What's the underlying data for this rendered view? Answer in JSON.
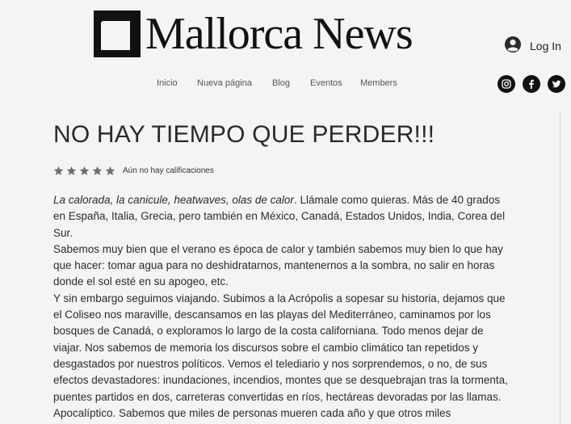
{
  "site": {
    "name": "Mallorca News"
  },
  "header": {
    "login_label": "Log In",
    "nav": [
      {
        "label": "Inicio"
      },
      {
        "label": "Nueva página"
      },
      {
        "label": "Blog"
      },
      {
        "label": "Eventos"
      },
      {
        "label": "Members"
      }
    ],
    "social": [
      "instagram-icon",
      "facebook-icon",
      "twitter-icon"
    ]
  },
  "post": {
    "title": "NO HAY TIEMPO QUE PERDER!!!",
    "rating": {
      "stars": 5,
      "value": 0,
      "label": "Aún no hay calificaciones"
    },
    "intro_italic": "La calorada, la canicule, heatwaves, olas de calor",
    "intro_rest": ". Llámale como quieras. Más de 40 grados en España, Italia, Grecia, pero también en México, Canadá, Estados Unidos, India, Corea del Sur.",
    "p2": "Sabemos muy bien que el verano es época de calor y también sabemos muy bien lo que hay que hacer: tomar agua para no deshidratarnos, mantenernos a la sombra, no salir en horas donde el sol esté en su apogeo, etc.",
    "p3": "Y sin embargo seguimos viajando. Subimos a la Acrópolis a sopesar su historia, dejamos que el Coliseo nos maraville, descansamos en las playas del Mediterráneo, caminamos por los bosques de Canadá, o exploramos lo largo de la costa californiana. Todo menos dejar de viajar. Nos sabemos de memoria los discursos sobre el cambio climático tan repetidos y desgastados por nuestros políticos. Vemos el telediario y nos sorprendemos, o no, de sus efectos devastadores: inundaciones, incendios, montes que se desquebrajan tras la tormenta, puentes partidos en dos, carreteras convertidas en ríos, hectáreas devoradas por las llamas. Apocalíptico. Sabemos que miles de personas mueren cada año y que otros miles"
  },
  "colors": {
    "star": "#6f6f6f",
    "background": "#f4f4f4",
    "text": "#2c2c2c"
  }
}
